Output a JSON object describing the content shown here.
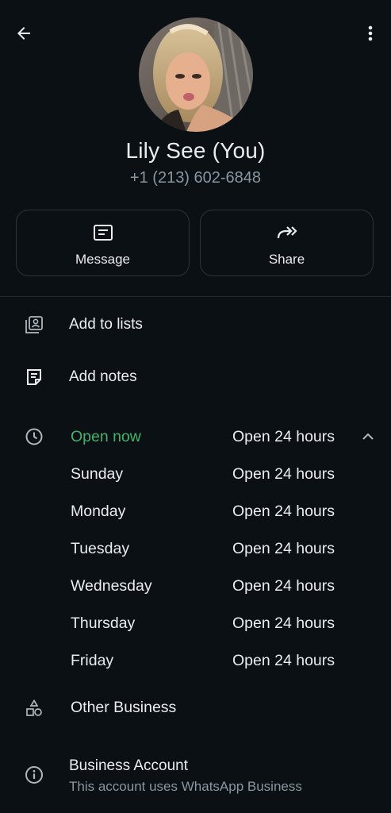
{
  "profile": {
    "name": "Lily See (You)",
    "phone": "+1 (213) 602-6848"
  },
  "actions": {
    "message_label": "Message",
    "share_label": "Share"
  },
  "list_items": {
    "add_to_lists": "Add to lists",
    "add_notes": "Add notes"
  },
  "hours": {
    "status": "Open now",
    "status_value": "Open 24 hours",
    "days": [
      {
        "day": "Sunday",
        "value": "Open 24 hours"
      },
      {
        "day": "Monday",
        "value": "Open 24 hours"
      },
      {
        "day": "Tuesday",
        "value": "Open 24 hours"
      },
      {
        "day": "Wednesday",
        "value": "Open 24 hours"
      },
      {
        "day": "Thursday",
        "value": "Open 24 hours"
      },
      {
        "day": "Friday",
        "value": "Open 24 hours"
      }
    ]
  },
  "category": "Other Business",
  "business_account": {
    "title": "Business Account",
    "subtitle": "This account uses WhatsApp Business"
  },
  "colors": {
    "background": "#0b1014",
    "text": "#e9edef",
    "secondary_text": "#8b979f",
    "open_green": "#3fb36b",
    "card_border": "#2c343a"
  },
  "icons": [
    "back-arrow-icon",
    "more-vert-icon",
    "message-icon",
    "share-icon",
    "contact-list-icon",
    "note-icon",
    "clock-icon",
    "chevron-up-icon",
    "shapes-icon",
    "info-icon"
  ]
}
